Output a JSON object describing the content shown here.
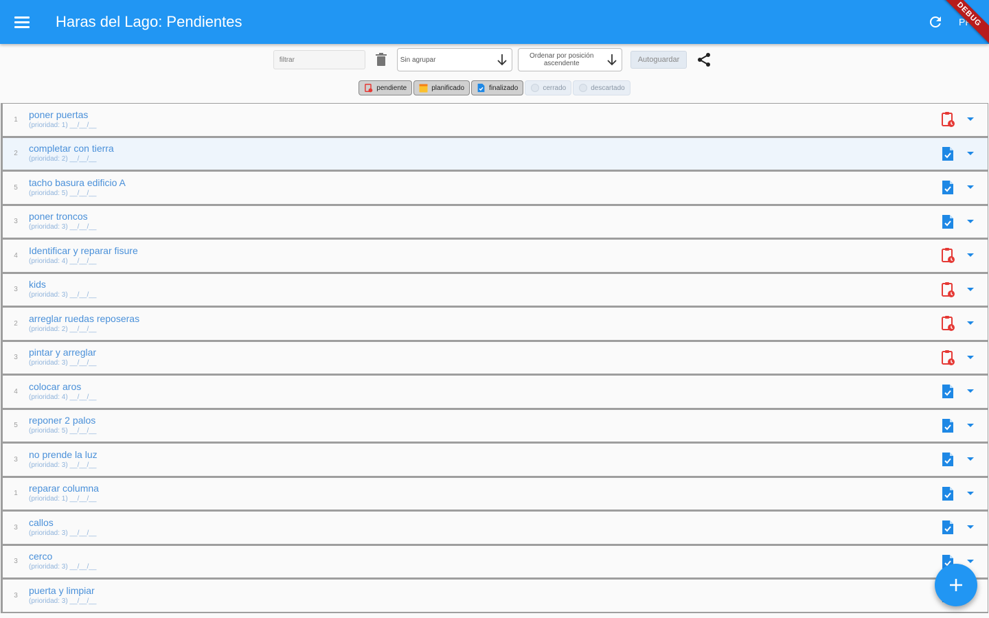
{
  "app_bar": {
    "title": "Haras del Lago: Pendientes",
    "user_initials": "PF",
    "debug_label": "DEBUG"
  },
  "toolbar": {
    "filter_placeholder": "filtrar",
    "group_dropdown": "Sin agrupar",
    "sort_dropdown": "Ordenar por posición ascendente",
    "autosave_label": "Autoguardar"
  },
  "status_chips": [
    {
      "label": "pendiente",
      "selected": true,
      "icon": "clipboard-clock-icon"
    },
    {
      "label": "planificado",
      "selected": true,
      "icon": "calendar-icon"
    },
    {
      "label": "finalizado",
      "selected": true,
      "icon": "document-check-icon"
    },
    {
      "label": "cerrado",
      "selected": false,
      "icon": "circle-icon"
    },
    {
      "label": "descartado",
      "selected": false,
      "icon": "circle-icon"
    }
  ],
  "tasks": [
    {
      "num": "1",
      "title": "poner puertas",
      "subtitle": "(prioridad: 1) __/__/__",
      "status": "pendiente",
      "status_icon": "clipboard-clock-icon"
    },
    {
      "num": "2",
      "title": "completar con tierra",
      "subtitle": "(prioridad: 2) __/__/__",
      "status": "finalizado",
      "status_icon": "document-check-icon"
    },
    {
      "num": "5",
      "title": "tacho basura edificio A",
      "subtitle": "(prioridad: 5) __/__/__",
      "status": "finalizado",
      "status_icon": "document-check-icon"
    },
    {
      "num": "3",
      "title": "poner troncos",
      "subtitle": "(prioridad: 3) __/__/__",
      "status": "finalizado",
      "status_icon": "document-check-icon"
    },
    {
      "num": "4",
      "title": "Identificar y reparar fisure",
      "subtitle": "(prioridad: 4) __/__/__",
      "status": "pendiente",
      "status_icon": "clipboard-clock-icon"
    },
    {
      "num": "3",
      "title": "kids",
      "subtitle": "(prioridad: 3) __/__/__",
      "status": "pendiente",
      "status_icon": "clipboard-clock-icon"
    },
    {
      "num": "2",
      "title": "arreglar ruedas reposeras",
      "subtitle": "(prioridad: 2) __/__/__",
      "status": "pendiente",
      "status_icon": "clipboard-clock-icon"
    },
    {
      "num": "3",
      "title": "pintar y arreglar",
      "subtitle": "(prioridad: 3) __/__/__",
      "status": "pendiente",
      "status_icon": "clipboard-clock-icon"
    },
    {
      "num": "4",
      "title": "colocar aros",
      "subtitle": "(prioridad: 4) __/__/__",
      "status": "finalizado",
      "status_icon": "document-check-icon"
    },
    {
      "num": "5",
      "title": "reponer 2 palos",
      "subtitle": "(prioridad: 5) __/__/__",
      "status": "finalizado",
      "status_icon": "document-check-icon"
    },
    {
      "num": "3",
      "title": "no prende la luz",
      "subtitle": "(prioridad: 3) __/__/__",
      "status": "finalizado",
      "status_icon": "document-check-icon"
    },
    {
      "num": "1",
      "title": "reparar columna",
      "subtitle": "(prioridad: 1) __/__/__",
      "status": "finalizado",
      "status_icon": "document-check-icon"
    },
    {
      "num": "3",
      "title": "callos",
      "subtitle": "(prioridad: 3) __/__/__",
      "status": "finalizado",
      "status_icon": "document-check-icon"
    },
    {
      "num": "3",
      "title": "cerco",
      "subtitle": "(prioridad: 3) __/__/__",
      "status": "finalizado",
      "status_icon": "document-check-icon"
    },
    {
      "num": "3",
      "title": "puerta y limpiar",
      "subtitle": "(prioridad: 3) __/__/__",
      "status": "finalizado",
      "status_icon": "document-check-icon"
    }
  ],
  "colors": {
    "primary": "#2196f3",
    "pending_icon": "#e53935",
    "finished_icon": "#1e88e5",
    "planned_icon": "#fbc02d"
  }
}
